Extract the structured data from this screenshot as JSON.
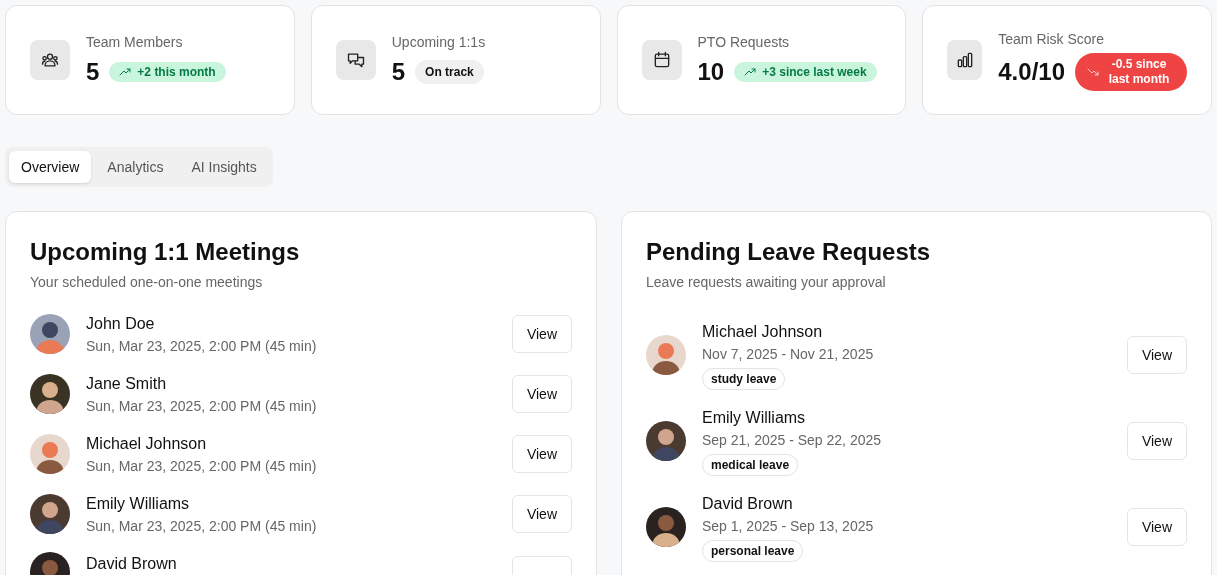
{
  "stats": [
    {
      "label": "Team Members",
      "value": "5",
      "badge": {
        "kind": "up",
        "text": "+2 this month"
      }
    },
    {
      "label": "Upcoming 1:1s",
      "value": "5",
      "badge": {
        "kind": "neutral",
        "text": "On track"
      }
    },
    {
      "label": "PTO Requests",
      "value": "10",
      "badge": {
        "kind": "up",
        "text": "+3 since last week"
      }
    },
    {
      "label": "Team Risk Score",
      "value": "4.0/10",
      "badge": {
        "kind": "down",
        "text": "-0.5 since last month"
      }
    }
  ],
  "tabs": [
    {
      "label": "Overview",
      "selected": true
    },
    {
      "label": "Analytics",
      "selected": false
    },
    {
      "label": "AI Insights",
      "selected": false
    }
  ],
  "meetings": {
    "title": "Upcoming 1:1 Meetings",
    "subtitle": "Your scheduled one-on-one meetings",
    "items": [
      {
        "name": "John Doe",
        "when": "Sun, Mar 23, 2025, 2:00 PM (45 min)",
        "action": "View"
      },
      {
        "name": "Jane Smith",
        "when": "Sun, Mar 23, 2025, 2:00 PM (45 min)",
        "action": "View"
      },
      {
        "name": "Michael Johnson",
        "when": "Sun, Mar 23, 2025, 2:00 PM (45 min)",
        "action": "View"
      },
      {
        "name": "Emily Williams",
        "when": "Sun, Mar 23, 2025, 2:00 PM (45 min)",
        "action": "View"
      },
      {
        "name": "David Brown"
      }
    ]
  },
  "leave": {
    "title": "Pending Leave Requests",
    "subtitle": "Leave requests awaiting your approval",
    "items": [
      {
        "name": "Michael Johnson",
        "dates": "Nov 7, 2025 - Nov 21, 2025",
        "type": "study leave",
        "action": "View"
      },
      {
        "name": "Emily Williams",
        "dates": "Sep 21, 2025 - Sep 22, 2025",
        "type": "medical leave",
        "action": "View"
      },
      {
        "name": "David Brown",
        "dates": "Sep 1, 2025 - Sep 13, 2025",
        "type": "personal leave",
        "action": "View"
      }
    ]
  }
}
